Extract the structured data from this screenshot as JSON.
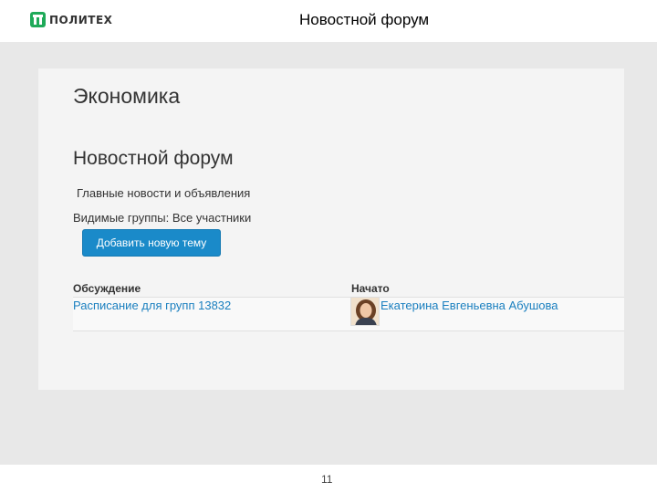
{
  "header": {
    "logo_text": "ПОЛИТЕХ",
    "title": "Новостной форум"
  },
  "course": {
    "title": "Экономика"
  },
  "forum": {
    "title": "Новостной форум",
    "description": "Главные новости и объявления",
    "visible_groups": "Видимые группы: Все участники",
    "add_topic_label": "Добавить новую тему"
  },
  "table": {
    "columns": [
      "Обсуждение",
      "Начато"
    ],
    "rows": [
      {
        "discussion": "Расписание для групп 13832",
        "author": "Екатерина Евгеньевна Абушова"
      }
    ]
  },
  "footer": {
    "page_number": "11"
  },
  "colors": {
    "brand_green": "#1faa59",
    "button_blue": "#1a8ac9",
    "link_blue": "#1a7fbf"
  }
}
